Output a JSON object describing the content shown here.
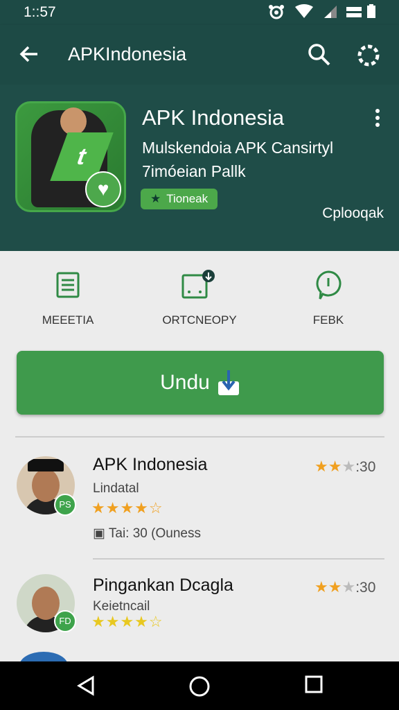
{
  "status_bar": {
    "time": "1::57"
  },
  "app_bar": {
    "title": "APKIndonesia",
    "icons": [
      "back-arrow-icon",
      "search-icon",
      "gear-icon"
    ]
  },
  "header": {
    "app_name": "APK Indonesia",
    "subtitle_line1": "Mulskendoia APK Cansirtyl",
    "subtitle_line2": "7imóeian Pallk",
    "tag_label": "Tioneak",
    "right_label": "Cplooqak",
    "icon_letter": "t"
  },
  "actions": [
    {
      "label": "MEEETIA",
      "icon": "document-icon"
    },
    {
      "label": "ORTCNEOPY",
      "icon": "screen-download-icon"
    },
    {
      "label": "FEBK",
      "icon": "chat-bubble-icon"
    }
  ],
  "download_button": {
    "label": "Undu"
  },
  "list": [
    {
      "name": "APK Indonesia",
      "developer": "Lindatal",
      "stars_display": "★★★★☆",
      "rating_stars": "★★",
      "rating_value": ":30",
      "badge": "PS",
      "meta": "Tai: 30 (Ouness"
    },
    {
      "name": "Pingankan Dcagla",
      "developer": "Keietncail",
      "stars_display": "★★★★☆",
      "rating_stars": "★★",
      "rating_value": ":30",
      "badge": "FD"
    }
  ],
  "colors": {
    "primary": "#1d4a45",
    "accent": "#3f9a4c",
    "star": "#f0a020"
  }
}
